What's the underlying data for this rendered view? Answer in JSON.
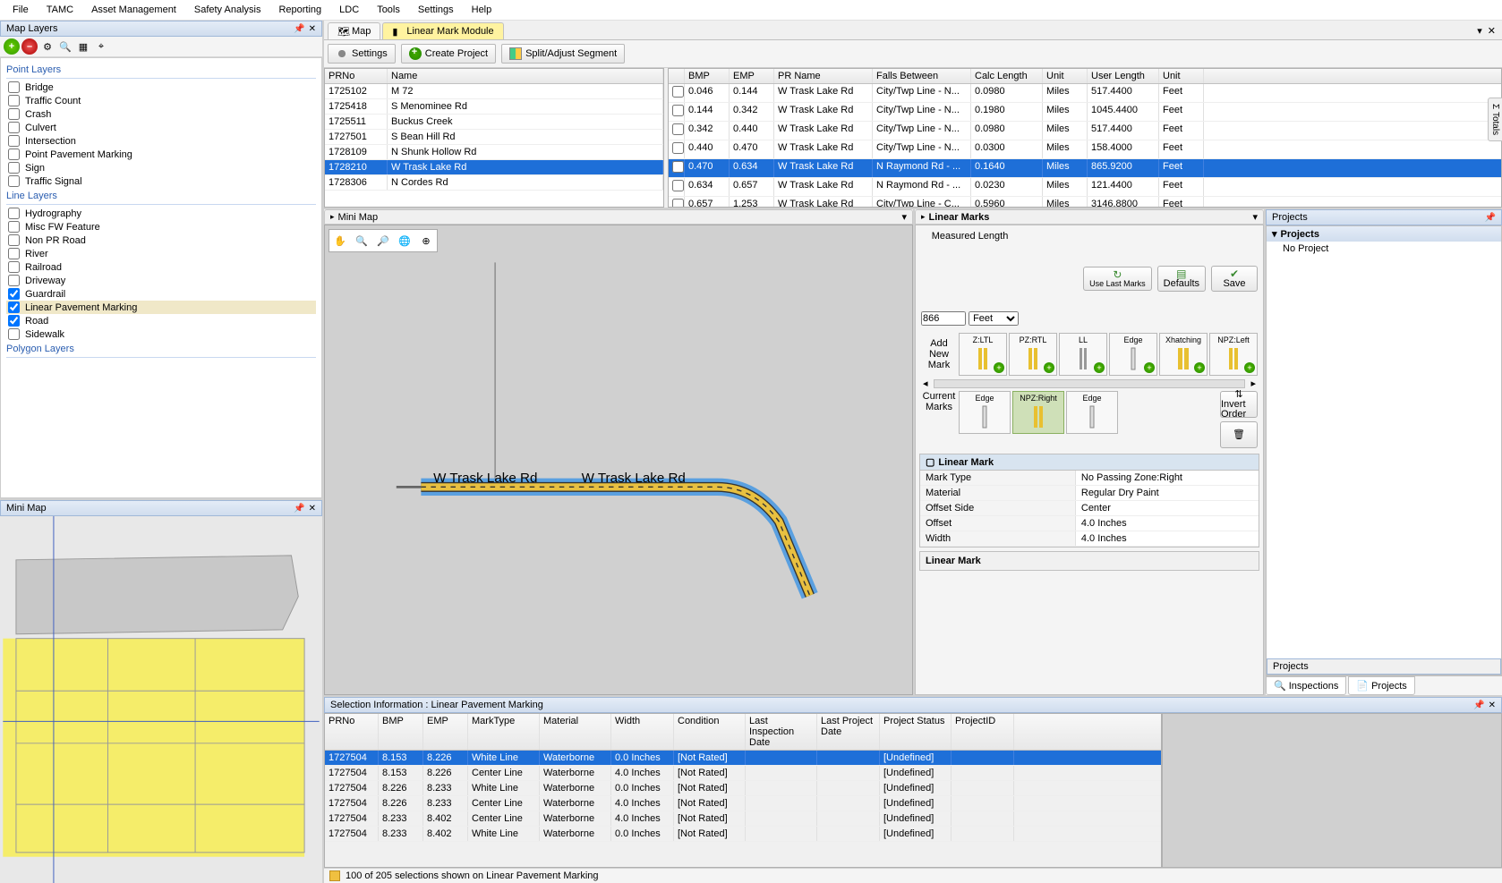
{
  "menu": [
    "File",
    "TAMC",
    "Asset Management",
    "Safety Analysis",
    "Reporting",
    "LDC",
    "Tools",
    "Settings",
    "Help"
  ],
  "mapLayers": {
    "title": "Map Layers",
    "groups": {
      "point": "Point Layers",
      "line": "Line Layers",
      "polygon": "Polygon Layers"
    },
    "point": [
      "Bridge",
      "Traffic Count",
      "Crash",
      "Culvert",
      "Intersection",
      "Point Pavement Marking",
      "Sign",
      "Traffic Signal"
    ],
    "line": [
      "Hydrography",
      "Misc FW Feature",
      "Non PR Road",
      "River",
      "Railroad",
      "Driveway",
      "Guardrail",
      "Linear Pavement Marking",
      "Road",
      "Sidewalk"
    ],
    "lineChecked": [
      6,
      7,
      8
    ],
    "lineSelected": 7
  },
  "miniMapTitle": "Mini Map",
  "tabs": {
    "map": "Map",
    "module": "Linear Mark Module"
  },
  "moduleButtons": {
    "settings": "Settings",
    "create": "Create Project",
    "split": "Split/Adjust Segment"
  },
  "prGrid": {
    "cols": [
      "PRNo",
      "Name"
    ],
    "rows": [
      [
        "1725102",
        "M 72"
      ],
      [
        "1725418",
        "S Menominee Rd"
      ],
      [
        "1725511",
        "Buckus Creek"
      ],
      [
        "1727501",
        "S Bean Hill Rd"
      ],
      [
        "1728109",
        "N Shunk Hollow Rd"
      ],
      [
        "1728210",
        "W Trask Lake Rd"
      ],
      [
        "1728306",
        "N Cordes Rd"
      ]
    ],
    "sel": 5
  },
  "segGrid": {
    "cols": [
      "BMP",
      "EMP",
      "PR Name",
      "Falls Between",
      "Calc Length",
      "Unit",
      "User Length",
      "Unit"
    ],
    "rows": [
      [
        "0.046",
        "0.144",
        "W Trask Lake Rd",
        "City/Twp Line - N...",
        "0.0980",
        "Miles",
        "517.4400",
        "Feet"
      ],
      [
        "0.144",
        "0.342",
        "W Trask Lake Rd",
        "City/Twp Line - N...",
        "0.1980",
        "Miles",
        "1045.4400",
        "Feet"
      ],
      [
        "0.342",
        "0.440",
        "W Trask Lake Rd",
        "City/Twp Line - N...",
        "0.0980",
        "Miles",
        "517.4400",
        "Feet"
      ],
      [
        "0.440",
        "0.470",
        "W Trask Lake Rd",
        "City/Twp Line - N...",
        "0.0300",
        "Miles",
        "158.4000",
        "Feet"
      ],
      [
        "0.470",
        "0.634",
        "W Trask Lake Rd",
        "N Raymond Rd - ...",
        "0.1640",
        "Miles",
        "865.9200",
        "Feet"
      ],
      [
        "0.634",
        "0.657",
        "W Trask Lake Rd",
        "N Raymond Rd - ...",
        "0.0230",
        "Miles",
        "121.4400",
        "Feet"
      ],
      [
        "0.657",
        "1.253",
        "W Trask Lake Rd",
        "City/Twp Line - C...",
        "0.5960",
        "Miles",
        "3146.8800",
        "Feet"
      ]
    ],
    "sel": 4
  },
  "miniMap2": {
    "title": "Mini Map",
    "roadLabel": "W Trask Lake Rd"
  },
  "linearMarks": {
    "title": "Linear Marks",
    "measuredLabel": "Measured Length",
    "measuredValue": "866",
    "measuredUnit": "Feet",
    "btns": {
      "useLast": "Use Last Marks",
      "defaults": "Defaults",
      "save": "Save"
    },
    "addLabel": "Add New Mark",
    "curLabel": "Current Marks",
    "addTiles": [
      "Z:LTL",
      "PZ:RTL",
      "LL",
      "Edge",
      "Xhatching",
      "NPZ:Left"
    ],
    "curTiles": [
      "Edge",
      "NPZ:Right",
      "Edge"
    ],
    "curSel": 1,
    "invert": "Invert Order",
    "section": "Linear Mark",
    "props": [
      [
        "Mark Type",
        "No Passing Zone:Right"
      ],
      [
        "Material",
        "Regular Dry Paint"
      ],
      [
        "Offset Side",
        "Center"
      ],
      [
        "Offset",
        "4.0 Inches"
      ],
      [
        "Width",
        "4.0 Inches"
      ]
    ],
    "footer": "Linear Mark"
  },
  "projects": {
    "title": "Projects",
    "node": "Projects",
    "leaf": "No Project",
    "footer": "Projects",
    "tabs": [
      "Inspections",
      "Projects"
    ]
  },
  "totalsTab": "Σ Totals",
  "selInfo": {
    "title": "Selection Information : Linear Pavement Marking",
    "cols": [
      "PRNo",
      "BMP",
      "EMP",
      "MarkType",
      "Material",
      "Width",
      "Condition",
      "Last Inspection Date",
      "Last Project Date",
      "Project Status",
      "ProjectID"
    ],
    "rows": [
      [
        "1727504",
        "8.153",
        "8.226",
        "White Line",
        "Waterborne",
        "0.0 Inches",
        "[Not Rated]",
        "",
        "",
        "[Undefined]",
        ""
      ],
      [
        "1727504",
        "8.153",
        "8.226",
        "Center Line",
        "Waterborne",
        "4.0 Inches",
        "[Not Rated]",
        "",
        "",
        "[Undefined]",
        ""
      ],
      [
        "1727504",
        "8.226",
        "8.233",
        "White Line",
        "Waterborne",
        "0.0 Inches",
        "[Not Rated]",
        "",
        "",
        "[Undefined]",
        ""
      ],
      [
        "1727504",
        "8.226",
        "8.233",
        "Center Line",
        "Waterborne",
        "4.0 Inches",
        "[Not Rated]",
        "",
        "",
        "[Undefined]",
        ""
      ],
      [
        "1727504",
        "8.233",
        "8.402",
        "Center Line",
        "Waterborne",
        "4.0 Inches",
        "[Not Rated]",
        "",
        "",
        "[Undefined]",
        ""
      ],
      [
        "1727504",
        "8.233",
        "8.402",
        "White Line",
        "Waterborne",
        "0.0 Inches",
        "[Not Rated]",
        "",
        "",
        "[Undefined]",
        ""
      ]
    ],
    "sel": 0,
    "status": "100 of 205 selections shown on Linear Pavement Marking"
  }
}
